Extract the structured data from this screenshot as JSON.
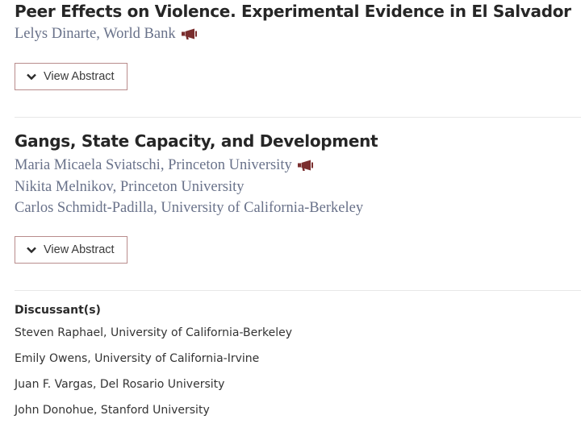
{
  "papers": [
    {
      "title": "Peer Effects on Violence. Experimental Evidence in El Salvador",
      "authors": [
        "Lelys Dinarte, World Bank"
      ],
      "presenter_icon": "megaphone-icon",
      "abstract_label": "View Abstract"
    },
    {
      "title": "Gangs, State Capacity, and Development",
      "authors": [
        "Maria Micaela Sviatschi, Princeton University",
        "Nikita Melnikov, Princeton University",
        "Carlos Schmidt-Padilla, University of California-Berkeley"
      ],
      "presenter_icon": "megaphone-icon",
      "abstract_label": "View Abstract"
    }
  ],
  "discussants": {
    "heading": "Discussant(s)",
    "items": [
      "Steven Raphael, University of California-Berkeley",
      "Emily Owens, University of California-Irvine",
      "Juan F. Vargas, Del Rosario University",
      "John Donohue, Stanford University"
    ]
  },
  "colors": {
    "author": "#69728a",
    "accent": "#7a2e2e",
    "button_border": "#b98c8c"
  }
}
